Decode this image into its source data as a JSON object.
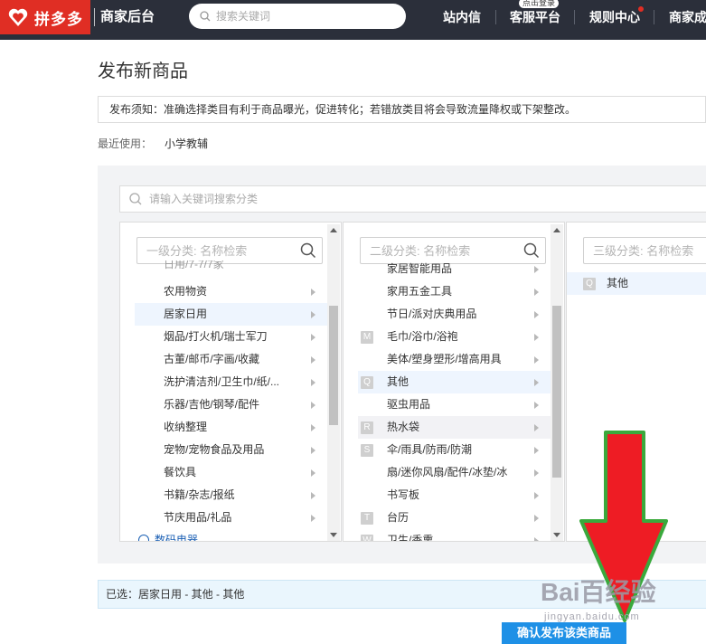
{
  "header": {
    "logo_text": "拼多多",
    "brand_name": "商家后台",
    "search_placeholder": "搜索关键词",
    "nav": [
      "站内信",
      "客服平台",
      "规则中心",
      "商家成"
    ],
    "nav_badge": "点击登录"
  },
  "page": {
    "title": "发布新商品",
    "notice": "发布须知：准确选择类目有利于商品曝光，促进转化；若错放类目将会导致流量降权或下架整改。",
    "recent_label": "最近使用：",
    "recent_items": [
      "小学教辅"
    ]
  },
  "category_search": {
    "placeholder": "请输入关键词搜索分类"
  },
  "level1": {
    "placeholder": "一级分类: 名称检索",
    "partial_top": "日用/7-7/7家",
    "items": [
      "农用物资",
      "居家日用",
      "烟品/打火机/瑞士军刀",
      "古董/邮币/字画/收藏",
      "洗护清洁剂/卫生巾/纸/...",
      "乐器/吉他/钢琴/配件",
      "收纳整理",
      "宠物/宠物食品及用品",
      "餐饮具",
      "书籍/杂志/报纸",
      "节庆用品/礼品"
    ],
    "selected": "居家日用",
    "more_link": "数码电器"
  },
  "level2": {
    "placeholder": "二级分类: 名称检索",
    "items": [
      {
        "letter": "",
        "label": "家居智能用品"
      },
      {
        "letter": "",
        "label": "家用五金工具"
      },
      {
        "letter": "",
        "label": "节日/派对庆典用品"
      },
      {
        "letter": "M",
        "label": "毛巾/浴巾/浴袍"
      },
      {
        "letter": "",
        "label": "美体/塑身塑形/增高用具"
      },
      {
        "letter": "Q",
        "label": "其他"
      },
      {
        "letter": "",
        "label": "驱虫用品"
      },
      {
        "letter": "R",
        "label": "热水袋"
      },
      {
        "letter": "S",
        "label": "伞/雨具/防雨/防潮"
      },
      {
        "letter": "",
        "label": "扇/迷你风扇/配件/冰垫/冰"
      },
      {
        "letter": "",
        "label": "书写板"
      },
      {
        "letter": "T",
        "label": "台历"
      },
      {
        "letter": "W",
        "label": "卫生/香熏"
      }
    ],
    "selected": "其他",
    "hover": "热水袋"
  },
  "level3": {
    "placeholder": "三级分类: 名称检索",
    "items": [
      {
        "letter": "Q",
        "label": "其他"
      }
    ],
    "selected": "其他"
  },
  "selection": {
    "text": "已选：居家日用 - 其他 - 其他"
  },
  "confirm_label": "确认发布该类商品",
  "watermark": {
    "main": "Bai百经验",
    "sub": "jingyan.baidu.com"
  },
  "colors": {
    "brand_red": "#e02e24",
    "nav_bg": "#2b2f3a",
    "primary_blue": "#1e90e6",
    "selected_bg": "#eef5fe",
    "annotation_red": "#ee1c24",
    "annotation_green": "#3aa93c"
  }
}
